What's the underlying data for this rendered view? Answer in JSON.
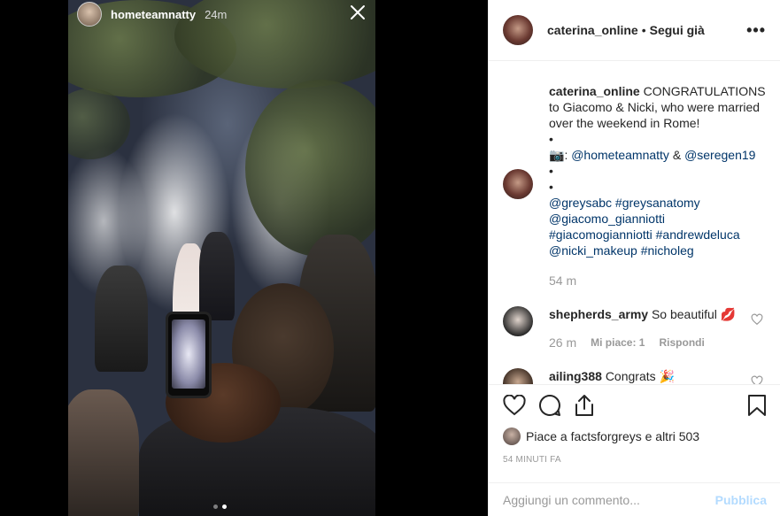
{
  "story": {
    "username": "hometeamnatty",
    "time": "24m",
    "close_icon": "close-icon",
    "dots_count": 2,
    "active_dot": 1
  },
  "header": {
    "username": "caterina_online",
    "separator": "•",
    "follow_label": "Segui già",
    "more_label": "•••"
  },
  "caption": {
    "username": "caterina_online",
    "text": "CONGRATULATIONS to Giacomo & Nicki, who were married over the weekend in Rome!",
    "bullet1": "•",
    "camera_emoji": "📷",
    "colon": ":",
    "tag1": "@hometeamnatty",
    "amp": "&",
    "tag2": "@seregen19",
    "bullet2": "•",
    "bullet3": "•",
    "mention_greys": "@greysabc",
    "hashtag_greys": "#greysanatomy",
    "mention_giacomo": "@giacomo_gianniotti",
    "hashtag_giacomo": "#giacomogianniotti",
    "hashtag_andrew": "#andrewdeluca",
    "mention_nicki": "@nicki_makeup",
    "hashtag_nicholeg": "#nicholeg",
    "time": "54 m"
  },
  "comments": [
    {
      "username": "shepherds_army",
      "text": "So beautiful",
      "emoji": "💋",
      "time": "26 m",
      "likes": "Mi piace: 1",
      "reply": "Rispondi"
    },
    {
      "username": "ailing388",
      "text": "Congrats",
      "emoji": "🎉"
    }
  ],
  "actions": {
    "icons": [
      "heart-icon",
      "comment-icon",
      "share-icon",
      "bookmark-icon"
    ],
    "likes_text": "Piace a factsforgreys e altri 503",
    "date": "54 MINUTI FA"
  },
  "add_comment": {
    "placeholder": "Aggiungi un commento...",
    "publish": "Pubblica"
  },
  "colors": {
    "link": "#003569",
    "muted": "#999999",
    "publish_disabled": "#b3dbff"
  }
}
